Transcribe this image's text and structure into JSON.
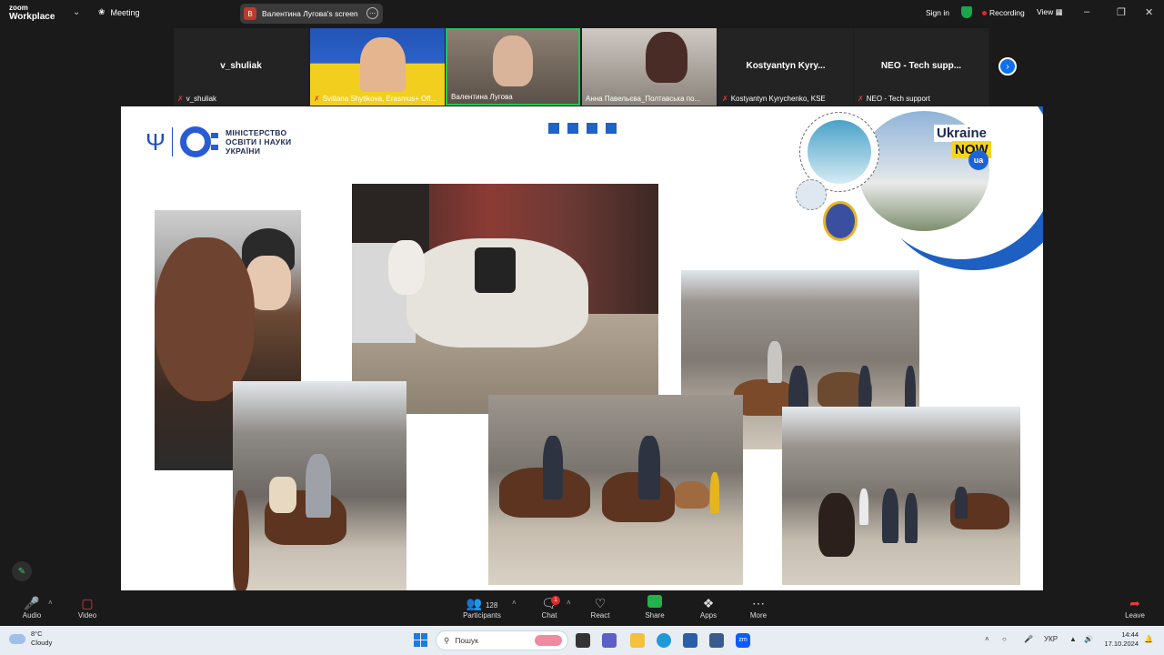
{
  "app": {
    "logo_line1": "zoom",
    "logo_line2": "Workplace",
    "meeting_label": "Meeting"
  },
  "share_pill": {
    "avatar_letter": "В",
    "label": "Валентина Лугова's screen"
  },
  "header_right": {
    "sign_in": "Sign in",
    "recording": "Recording",
    "view": "View"
  },
  "participants": [
    {
      "name_display": "v_shuliak",
      "caption": "v_shuliak",
      "muted": true
    },
    {
      "name_display": "",
      "caption": "Svitlana Shytikova, Erasmus+ Off...",
      "muted": true
    },
    {
      "name_display": "",
      "caption": "Валентина Лугова",
      "muted": false
    },
    {
      "name_display": "",
      "caption": "Анна Павельєва_Полтавська по...",
      "muted": false
    },
    {
      "name_display": "Kostyantyn  Kyry...",
      "caption": "Kostyantyn Kyrychenko, KSE",
      "muted": true
    },
    {
      "name_display": "NEO - Tech supp...",
      "caption": "NEO - Tech support",
      "muted": true
    }
  ],
  "slide": {
    "ministry_line1": "МІНІСТЕРСТВО",
    "ministry_line2": "ОСВІТИ І НАУКИ",
    "ministry_line3": "УКРАЇНИ",
    "ukraine": "Ukraine",
    "now": "NOW",
    "ua": "ua"
  },
  "toolbar": {
    "audio": "Audio",
    "video": "Video",
    "participants": "Participants",
    "participants_count": "128",
    "chat": "Chat",
    "chat_badge": "1",
    "react": "React",
    "share": "Share",
    "apps": "Apps",
    "more": "More",
    "leave": "Leave"
  },
  "taskbar": {
    "temp": "8°C",
    "weather": "Cloudy",
    "search_placeholder": "Пошук",
    "lang": "УКР",
    "time": "14:44",
    "date": "17.10.2024"
  },
  "colors": {
    "accent": "#0e71eb",
    "recording": "#e02828",
    "ministry_blue": "#2a5bd7",
    "share_green": "#24b24a"
  }
}
